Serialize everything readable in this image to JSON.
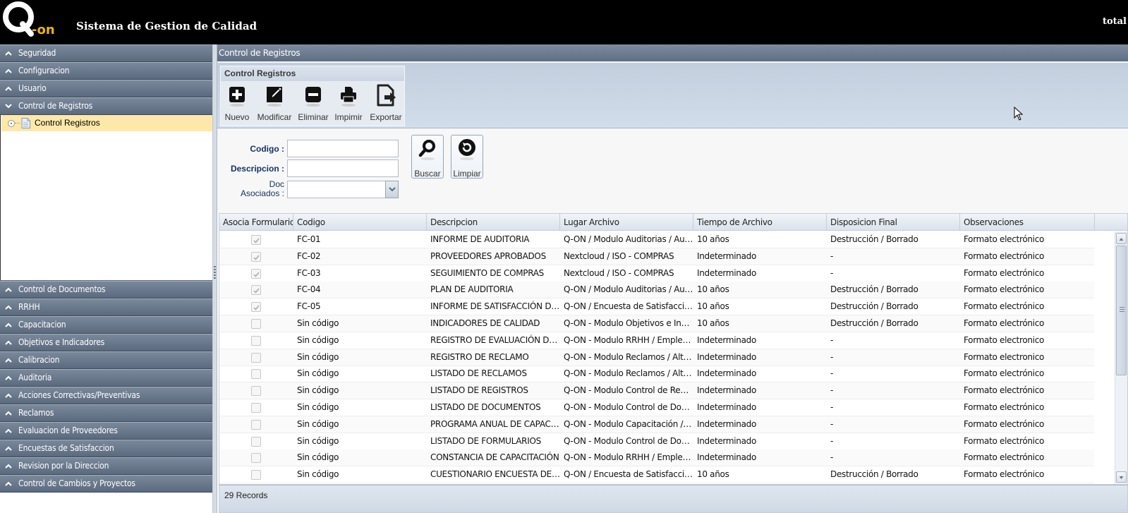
{
  "header": {
    "logo_text": "Q-on",
    "title": "Sistema de Gestion de Calidad",
    "user": "total",
    "accent_color": "#e8b613"
  },
  "sidebar": {
    "top_items": [
      {
        "label": "Seguridad",
        "expanded": false
      },
      {
        "label": "Configuracion",
        "expanded": false
      },
      {
        "label": "Usuario",
        "expanded": false
      },
      {
        "label": "Control de Registros",
        "expanded": true
      }
    ],
    "tree_items": [
      {
        "label": "Control Registros",
        "selected": true
      }
    ],
    "bottom_items": [
      {
        "label": "Control de Documentos"
      },
      {
        "label": "RRHH"
      },
      {
        "label": "Capacitacion"
      },
      {
        "label": "Objetivos e Indicadores"
      },
      {
        "label": "Calibracion"
      },
      {
        "label": "Auditoria"
      },
      {
        "label": "Acciones Correctivas/Preventivas"
      },
      {
        "label": "Reclamos"
      },
      {
        "label": "Evaluacion de Proveedores"
      },
      {
        "label": "Encuestas de Satisfaccion"
      },
      {
        "label": "Revision por la Direccion"
      },
      {
        "label": "Control de Cambios y Proyectos"
      }
    ]
  },
  "main": {
    "panel_title": "Control de Registros",
    "toolbar": {
      "group_title": "Control Registros",
      "buttons": [
        {
          "label": "Nuevo",
          "icon": "plus-square-icon"
        },
        {
          "label": "Modificar",
          "icon": "edit-icon"
        },
        {
          "label": "Eliminar",
          "icon": "minus-square-icon"
        },
        {
          "label": "Impimir",
          "icon": "printer-icon"
        },
        {
          "label": "Exportar",
          "icon": "export-icon"
        }
      ]
    },
    "search": {
      "codigo_label": "Codigo :",
      "codigo_value": "",
      "descripcion_label": "Descripcion :",
      "descripcion_value": "",
      "doc_label_line1": "Doc",
      "doc_label_line2": "Asociados :",
      "doc_value": "",
      "buscar_label": "Buscar",
      "limpiar_label": "Limpiar"
    },
    "grid": {
      "columns": [
        "Asocia Formulario",
        "Codigo",
        "Descripcion",
        "Lugar Archivo",
        "Tiempo de Archivo",
        "Disposicion Final",
        "Observaciones"
      ],
      "rows": [
        {
          "asocia": true,
          "codigo": "FC-01",
          "descripcion": "INFORME DE AUDITORIA",
          "lugar": "Q-ON / Modulo Auditorias / Audit...",
          "tiempo": "10 años",
          "disposicion": "Destrucción / Borrado",
          "observaciones": "Formato electrónico"
        },
        {
          "asocia": true,
          "codigo": "FC-02",
          "descripcion": "PROVEEDORES APROBADOS",
          "lugar": "Nextcloud / ISO - COMPRAS",
          "tiempo": "Indeterminado",
          "disposicion": "-",
          "observaciones": "Formato electrónico"
        },
        {
          "asocia": true,
          "codigo": "FC-03",
          "descripcion": "SEGUIMIENTO DE COMPRAS",
          "lugar": "Nextcloud / ISO - COMPRAS",
          "tiempo": "Indeterminado",
          "disposicion": "-",
          "observaciones": "Formato electrónico"
        },
        {
          "asocia": true,
          "codigo": "FC-04",
          "descripcion": "PLAN DE AUDITORIA",
          "lugar": "Q-ON / Modulo Auditorias / Audit...",
          "tiempo": "10 años",
          "disposicion": "Destrucción / Borrado",
          "observaciones": "Formato electrónico"
        },
        {
          "asocia": true,
          "codigo": "FC-05",
          "descripcion": "INFORME DE SATISFACCIÓN DE...",
          "lugar": "Q-ON / Encuesta de Satisfacción ...",
          "tiempo": "10 años",
          "disposicion": "Destrucción / Borrado",
          "observaciones": "Formato electrónico"
        },
        {
          "asocia": false,
          "codigo": "Sin código",
          "descripcion": "INDICADORES DE CALIDAD",
          "lugar": "Q-ON - Modulo Objetivos e Indic...",
          "tiempo": "10 años",
          "disposicion": "Destrucción / Borrado",
          "observaciones": "Formato electrónico"
        },
        {
          "asocia": false,
          "codigo": "Sin código",
          "descripcion": "REGISTRO DE EVALUACIÓN DE ...",
          "lugar": "Q-ON - Modulo RRHH / Emplead...",
          "tiempo": "Indeterminado",
          "disposicion": "-",
          "observaciones": "Formato electronico"
        },
        {
          "asocia": false,
          "codigo": "Sin código",
          "descripcion": "REGISTRO DE RECLAMO",
          "lugar": "Q-ON - Modulo Reclamos / Alta y...",
          "tiempo": "Indeterminado",
          "disposicion": "-",
          "observaciones": "Formato electronico"
        },
        {
          "asocia": false,
          "codigo": "Sin código",
          "descripcion": "LISTADO DE RECLAMOS",
          "lugar": "Q-ON - Modulo Reclamos / Alta y...",
          "tiempo": "Indeterminado",
          "disposicion": "-",
          "observaciones": "Formato electrónico"
        },
        {
          "asocia": false,
          "codigo": "Sin código",
          "descripcion": "LISTADO DE REGISTROS",
          "lugar": "Q-ON - Modulo Control de Regist...",
          "tiempo": "Indeterminado",
          "disposicion": "-",
          "observaciones": "Formato electrónico"
        },
        {
          "asocia": false,
          "codigo": "Sin código",
          "descripcion": "LISTADO DE DOCUMENTOS",
          "lugar": "Q-ON - Modulo Control de Docu...",
          "tiempo": "Indeterminado",
          "disposicion": "-",
          "observaciones": "Formato electrónico"
        },
        {
          "asocia": false,
          "codigo": "Sin código",
          "descripcion": "PROGRAMA ANUAL DE CAPACIT...",
          "lugar": "Q-ON - Modulo Capacitación / Co...",
          "tiempo": "Indeterminado",
          "disposicion": "-",
          "observaciones": "Formato electrónico"
        },
        {
          "asocia": false,
          "codigo": "Sin código",
          "descripcion": "LISTADO DE FORMULARIOS",
          "lugar": "Q-ON - Modulo Control de Docu...",
          "tiempo": "Indeterminado",
          "disposicion": "-",
          "observaciones": "Formato electrónico"
        },
        {
          "asocia": false,
          "codigo": "Sin código",
          "descripcion": "CONSTANCIA DE CAPACITACIÓN",
          "lugar": "Q-ON - Modulo RRHH / Emplead...",
          "tiempo": "Indeterminado",
          "disposicion": "-",
          "observaciones": "Formato electrónico"
        },
        {
          "asocia": false,
          "codigo": "Sin código",
          "descripcion": "CUESTIONARIO ENCUESTA DE S...",
          "lugar": "Q-ON / Encuesta de Satisfacción ...",
          "tiempo": "10 años",
          "disposicion": "Destrucción / Borrado",
          "observaciones": "Formato electrónico"
        }
      ],
      "footer": "29 Records"
    }
  }
}
